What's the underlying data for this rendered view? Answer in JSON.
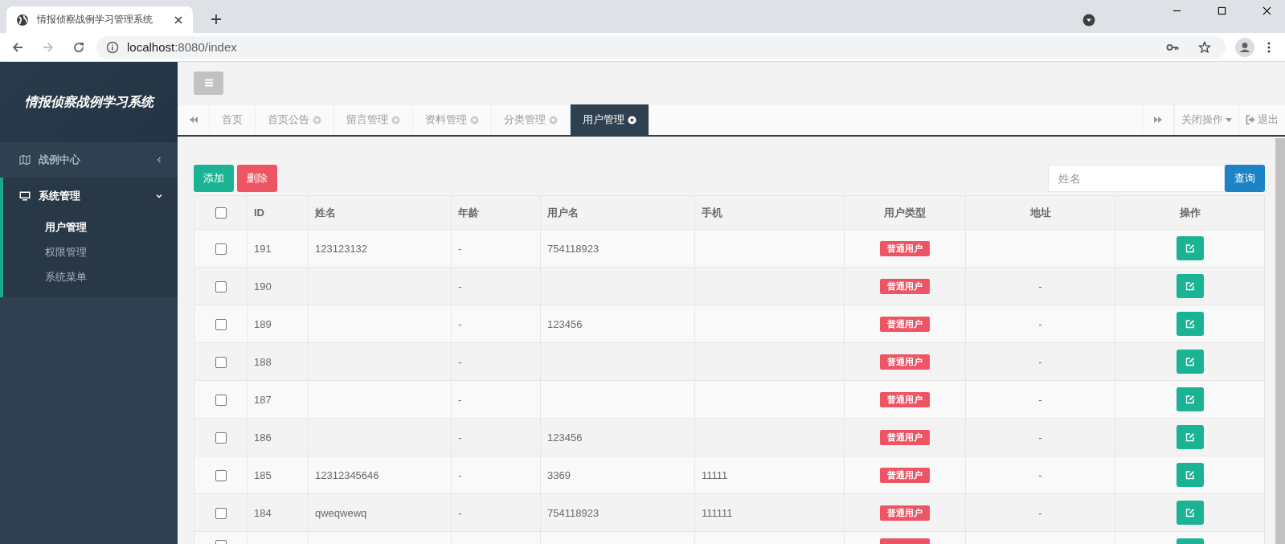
{
  "browser": {
    "tab_title": "情报侦察战例学习管理系统",
    "address_host": "localhost",
    "address_path": ":8080/index"
  },
  "sidebar": {
    "logo": "情报侦察战例学习系统",
    "menu": [
      {
        "label": "战例中心",
        "expanded": false
      },
      {
        "label": "系统管理",
        "expanded": true,
        "children": [
          {
            "label": "用户管理",
            "selected": true
          },
          {
            "label": "权限管理",
            "selected": false
          },
          {
            "label": "系统菜单",
            "selected": false
          }
        ]
      }
    ]
  },
  "tabs": [
    {
      "label": "首页",
      "closable": false,
      "selected": false
    },
    {
      "label": "首页公告",
      "closable": true,
      "selected": false
    },
    {
      "label": "留言管理",
      "closable": true,
      "selected": false
    },
    {
      "label": "资料管理",
      "closable": true,
      "selected": false
    },
    {
      "label": "分类管理",
      "closable": true,
      "selected": false
    },
    {
      "label": "用户管理",
      "closable": true,
      "selected": true
    }
  ],
  "tab_actions": {
    "close_menu": "关闭操作",
    "logout": "退出"
  },
  "toolbar": {
    "add": "添加",
    "delete": "删除",
    "search_placeholder": "姓名",
    "search": "查询"
  },
  "table": {
    "header_checked": false,
    "columns": [
      "ID",
      "姓名",
      "年龄",
      "用户名",
      "手机",
      "用户类型",
      "地址",
      "操作"
    ],
    "rows": [
      {
        "checked": false,
        "id": "191",
        "name": "123123132",
        "age": "-",
        "username": "754118923",
        "phone": "",
        "user_type": "普通用户",
        "address": ""
      },
      {
        "checked": false,
        "id": "190",
        "name": "",
        "age": "-",
        "username": "",
        "phone": "",
        "user_type": "普通用户",
        "address": "-"
      },
      {
        "checked": false,
        "id": "189",
        "name": "",
        "age": "-",
        "username": "123456",
        "phone": "",
        "user_type": "普通用户",
        "address": "-"
      },
      {
        "checked": false,
        "id": "188",
        "name": "",
        "age": "-",
        "username": "",
        "phone": "",
        "user_type": "普通用户",
        "address": "-"
      },
      {
        "checked": false,
        "id": "187",
        "name": "",
        "age": "-",
        "username": "",
        "phone": "",
        "user_type": "普通用户",
        "address": "-"
      },
      {
        "checked": false,
        "id": "186",
        "name": "",
        "age": "-",
        "username": "123456",
        "phone": "",
        "user_type": "普通用户",
        "address": "-"
      },
      {
        "checked": false,
        "id": "185",
        "name": "12312345646",
        "age": "-",
        "username": "3369",
        "phone": "11111",
        "user_type": "普通用户",
        "address": "-"
      },
      {
        "checked": false,
        "id": "184",
        "name": "qweqwewq",
        "age": "-",
        "username": "754118923",
        "phone": "111111",
        "user_type": "普通用户",
        "address": "-"
      },
      {
        "checked": false,
        "kind": "partial"
      }
    ]
  }
}
